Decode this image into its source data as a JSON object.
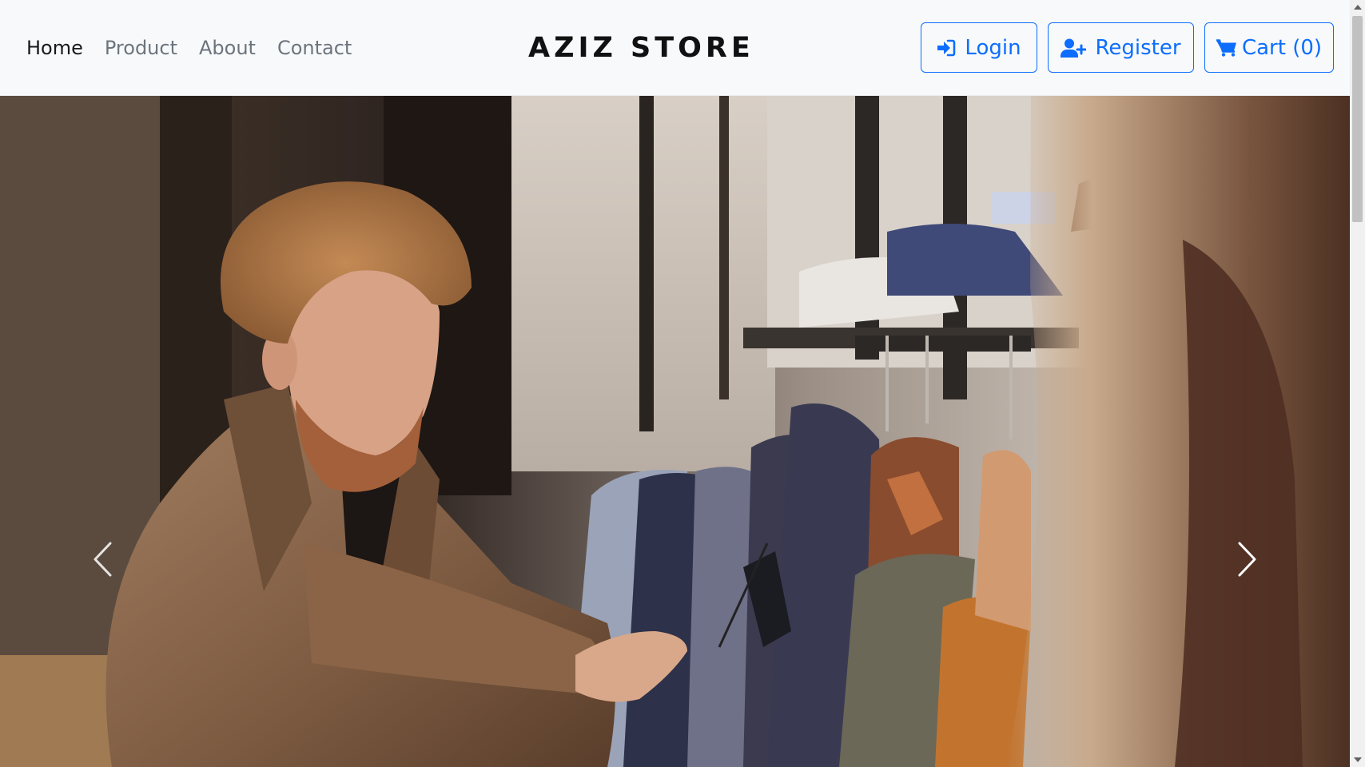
{
  "nav": {
    "links": [
      {
        "label": "Home",
        "active": true
      },
      {
        "label": "Product",
        "active": false
      },
      {
        "label": "About",
        "active": false
      },
      {
        "label": "Contact",
        "active": false
      }
    ],
    "brand": "AZIZ STORE",
    "buttons": {
      "login": {
        "label": "Login",
        "icon": "sign-in-icon"
      },
      "register": {
        "label": "Register",
        "icon": "user-plus-icon"
      },
      "cart": {
        "label": "Cart (0)",
        "icon": "shopping-cart-icon"
      }
    }
  },
  "hero": {
    "image": "man-in-brown-coat-browsing-clothes-rack",
    "controls": {
      "prev_icon": "chevron-left-icon",
      "next_icon": "chevron-right-icon"
    }
  },
  "colors": {
    "primary": "#0d6efd",
    "navbar_bg": "#f8f9fa",
    "nav_link": "#6c757d",
    "nav_link_active": "#1a1a1a"
  }
}
